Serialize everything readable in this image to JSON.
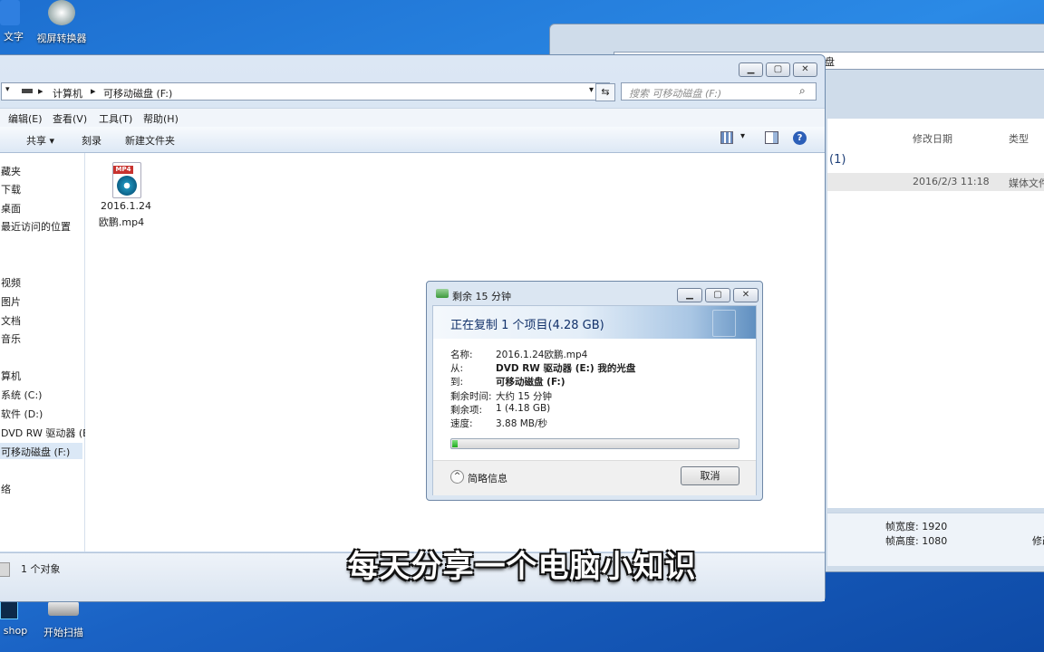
{
  "desktop": {
    "icons": [
      {
        "label": "文字"
      },
      {
        "label": "视屏转换器"
      },
      {
        "label": "shop"
      },
      {
        "label": "开始扫描"
      }
    ]
  },
  "back_window": {
    "title_partial": "盘",
    "columns": {
      "modified": "修改日期",
      "type": "类型"
    },
    "group": "(1)",
    "row": {
      "modified": "2016/2/3 11:18",
      "type": "媒体文件"
    },
    "details": {
      "width": "帧宽度: 1920",
      "height": "帧高度: 1080",
      "other": "修改"
    }
  },
  "explorer": {
    "address": {
      "root": "计算机",
      "current": "可移动磁盘 (F:)"
    },
    "search_placeholder": "搜索 可移动磁盘 (F:)",
    "menu": [
      "编辑(E)",
      "查看(V)",
      "工具(T)",
      "帮助(H)"
    ],
    "toolbar": {
      "share": "共享 ▾",
      "burn": "刻录",
      "new_folder": "新建文件夹"
    },
    "nav_items": [
      {
        "label": "藏夹"
      },
      {
        "label": "下载"
      },
      {
        "label": "桌面"
      },
      {
        "label": "最近访问的位置"
      },
      {
        "label": "视频"
      },
      {
        "label": "图片"
      },
      {
        "label": "文档"
      },
      {
        "label": "音乐"
      },
      {
        "label": "算机"
      },
      {
        "label": "系统 (C:)"
      },
      {
        "label": "软件 (D:)"
      },
      {
        "label": "DVD RW 驱动器 (E"
      },
      {
        "label": "可移动磁盘 (F:)"
      },
      {
        "label": "络"
      }
    ],
    "file": {
      "badge": "MP4",
      "name_line1": "2016.1.24",
      "name_line2": "欧鹏.mp4"
    },
    "status": "1 个对象"
  },
  "copy_dialog": {
    "title": "剩余 15 分钟",
    "heading": "正在复制 1 个项目(4.28 GB)",
    "rows": [
      {
        "label": "名称:",
        "value": "2016.1.24欧鹏.mp4"
      },
      {
        "label": "从:",
        "value": "DVD RW 驱动器 (E:) 我的光盘"
      },
      {
        "label": "到:",
        "value": "可移动磁盘 (F:)"
      },
      {
        "label": "剩余时间:",
        "value": "大约 15 分钟"
      },
      {
        "label": "剩余项:",
        "value": "1 (4.18 GB)"
      },
      {
        "label": "速度:",
        "value": "3.88 MB/秒"
      }
    ],
    "progress": 0.02,
    "less_info": "简略信息",
    "cancel": "取消"
  },
  "subtitle": "每天分享一个电脑小知识",
  "colors": {
    "progress_fill": "#1faa1f",
    "accent": "#2b8ae6"
  }
}
